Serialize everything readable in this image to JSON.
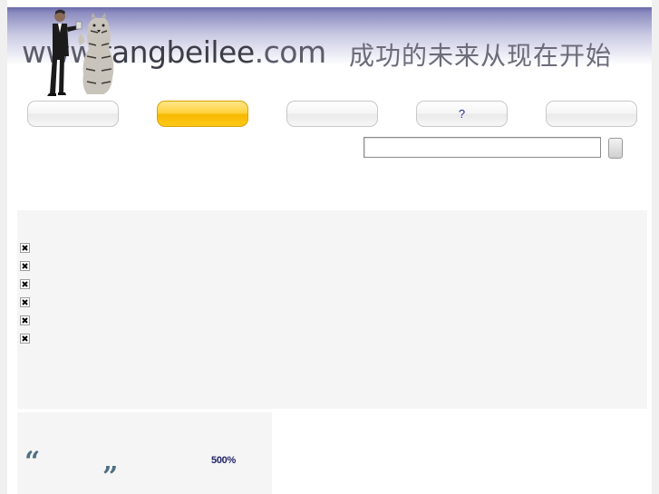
{
  "header": {
    "logo_prefix": "www.",
    "logo_main": "tangbeilee",
    "logo_suffix": ".com",
    "slogan": "成功的未来从现在开始"
  },
  "nav": {
    "items": [
      {
        "label": "",
        "active": false
      },
      {
        "label": "",
        "active": true
      },
      {
        "label": "",
        "active": false
      },
      {
        "label": "?",
        "active": false
      },
      {
        "label": "",
        "active": false
      }
    ]
  },
  "search": {
    "value": "",
    "button_label": ""
  },
  "list": {
    "items": [
      {
        "icon": "broken-image-icon"
      },
      {
        "icon": "broken-image-icon"
      },
      {
        "icon": "broken-image-icon"
      },
      {
        "icon": "broken-image-icon"
      },
      {
        "icon": "broken-image-icon"
      },
      {
        "icon": "broken-image-icon"
      }
    ]
  },
  "quote": {
    "open_mark": "“",
    "close_mark": "”",
    "highlight": "500%"
  },
  "colors": {
    "accent": "#ffc91a",
    "link": "#2a2aa0",
    "quote_mark": "#4e6f82"
  }
}
